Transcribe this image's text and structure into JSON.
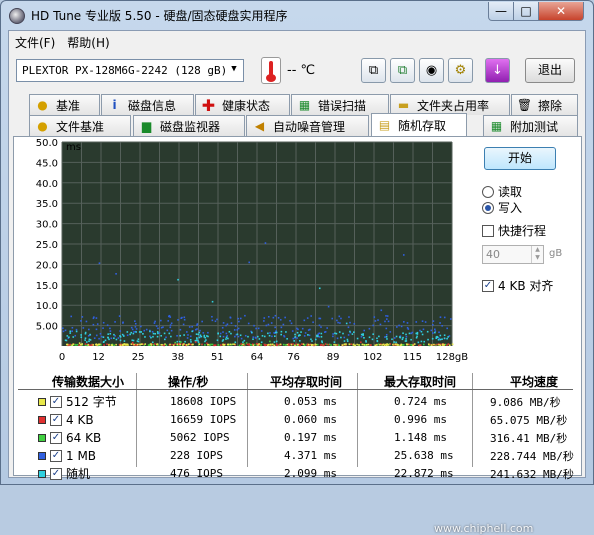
{
  "window": {
    "title": "HD Tune 专业版 5.50 - 硬盘/固态硬盘实用程序",
    "min_label": "—",
    "max_label": "□",
    "close_label": "✕"
  },
  "menu": [
    "文件(F)",
    "帮助(H)"
  ],
  "toolbar": {
    "drive": "PLEXTOR PX-128M6G-2242 (128 gB)",
    "temperature": "-- ℃",
    "exit_label": "退出",
    "icons": [
      "copy-icon",
      "copy-info-icon",
      "camera-icon",
      "settings-icon",
      "download-icon"
    ]
  },
  "tabs_row1": [
    {
      "label": "基准",
      "icon": "lightbulb-icon"
    },
    {
      "label": "磁盘信息",
      "icon": "info-icon"
    },
    {
      "label": "健康状态",
      "icon": "health-cross-icon"
    },
    {
      "label": "错误扫描",
      "icon": "scan-icon"
    },
    {
      "label": "文件夹占用率",
      "icon": "folder-icon"
    },
    {
      "label": "擦除",
      "icon": "trash-icon"
    }
  ],
  "tabs_row2": [
    {
      "label": "文件基准",
      "icon": "file-bulb-icon"
    },
    {
      "label": "磁盘监视器",
      "icon": "monitor-chart-icon"
    },
    {
      "label": "自动噪音管理",
      "icon": "speaker-icon"
    },
    {
      "label": "随机存取",
      "icon": "random-access-icon",
      "active": true
    },
    {
      "label": "附加测试",
      "icon": "extra-test-icon"
    }
  ],
  "controls": {
    "start_label": "开始",
    "read_label": "读取",
    "write_label": "写入",
    "selected_mode": "write",
    "quick_label": "快捷行程",
    "quick_checked": false,
    "quick_value": "40",
    "quick_unit": "gB",
    "align_label": "4 KB 对齐",
    "align_checked": true
  },
  "chart_data": {
    "type": "scatter",
    "ylabel": "ms",
    "xlabel": "",
    "y_ticks": [
      "50.0",
      "45.0",
      "40.0",
      "35.0",
      "30.0",
      "25.0",
      "20.0",
      "15.0",
      "10.0",
      "5.00"
    ],
    "x_ticks": [
      "0",
      "12",
      "25",
      "38",
      "51",
      "64",
      "76",
      "89",
      "102",
      "115",
      "128gB"
    ],
    "xlim": [
      0,
      128
    ],
    "ylim": [
      0,
      50
    ],
    "grid": true,
    "series": [
      {
        "name": "512 字节",
        "color": "#e8e84a",
        "mean_ms": 0.053,
        "max_ms": 0.724
      },
      {
        "name": "4 KB",
        "color": "#e03030",
        "mean_ms": 0.06,
        "max_ms": 0.996
      },
      {
        "name": "64 KB",
        "color": "#40d040",
        "mean_ms": 0.197,
        "max_ms": 1.148
      },
      {
        "name": "1 MB",
        "color": "#3060e0",
        "mean_ms": 4.371,
        "max_ms": 25.638
      },
      {
        "name": "随机",
        "color": "#30d0e0",
        "mean_ms": 2.099,
        "max_ms": 22.872
      }
    ]
  },
  "table": {
    "headers": [
      "传输数据大小",
      "操作/秒",
      "平均存取时间",
      "最大存取时间",
      "平均速度"
    ],
    "rows": [
      {
        "size": "512 字节",
        "iops": "18608 IOPS",
        "avg": "0.053 ms",
        "max": "0.724 ms",
        "speed": "9.086 MB/秒",
        "color": "#e8e84a"
      },
      {
        "size": "4 KB",
        "iops": "16659 IOPS",
        "avg": "0.060 ms",
        "max": "0.996 ms",
        "speed": "65.075 MB/秒",
        "color": "#e03030"
      },
      {
        "size": "64 KB",
        "iops": "5062 IOPS",
        "avg": "0.197 ms",
        "max": "1.148 ms",
        "speed": "316.41 MB/秒",
        "color": "#40d040"
      },
      {
        "size": "1 MB",
        "iops": "228 IOPS",
        "avg": "4.371 ms",
        "max": "25.638 ms",
        "speed": "228.744 MB/秒",
        "color": "#3060e0"
      },
      {
        "size": "随机",
        "iops": "476 IOPS",
        "avg": "2.099 ms",
        "max": "22.872 ms",
        "speed": "241.632 MB/秒",
        "color": "#30d0e0"
      }
    ]
  },
  "watermark": "www.chiphell.com"
}
